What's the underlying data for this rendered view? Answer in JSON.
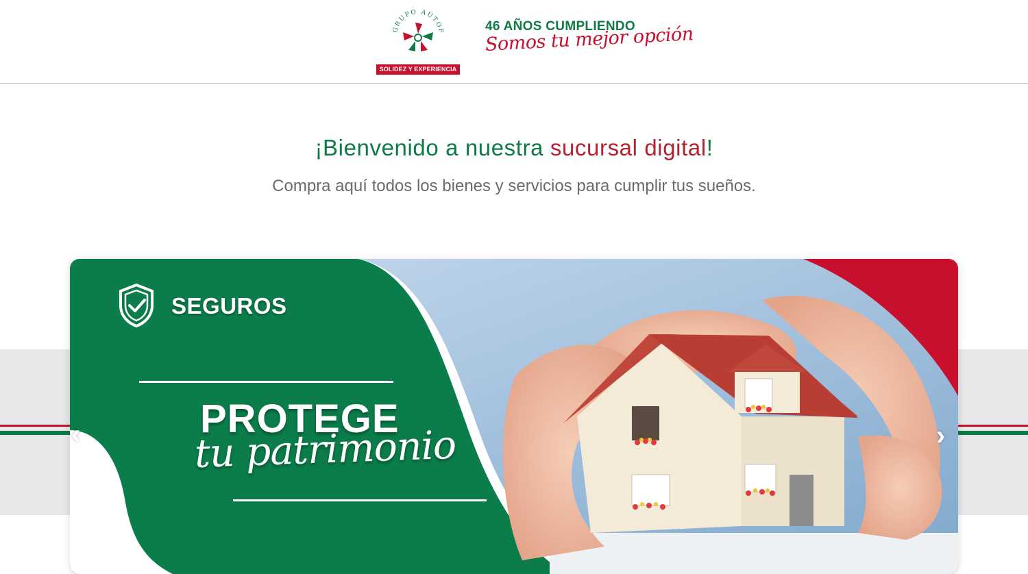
{
  "header": {
    "logo": {
      "arc_text": "GRUPO AUTOFIN MEXICO",
      "ribbon": "SOLIDEZ Y EXPERIENCIA"
    },
    "anniversary_title": "46 AÑOS CUMPLIENDO",
    "anniversary_slogan": "Somos tu mejor opción"
  },
  "welcome": {
    "prefix": "¡Bienvenido a nuestra ",
    "highlight": "sucursal digital",
    "suffix": "!",
    "subtitle": "Compra aquí todos los bienes y servicios para cumplir tus sueños."
  },
  "banner": {
    "category": "SEGUROS",
    "headline": "PROTEGE",
    "headline_script": "tu patrimonio",
    "prev_arrow": "‹",
    "next_arrow": "›"
  },
  "colors": {
    "brand_green": "#107a45",
    "brand_red": "#c8102e",
    "text_gray": "#6b6b6b",
    "band_gray": "#e6e7e8"
  },
  "icons": [
    "autofin-logo-icon",
    "shield-check-icon",
    "chevron-left-icon",
    "chevron-right-icon"
  ]
}
